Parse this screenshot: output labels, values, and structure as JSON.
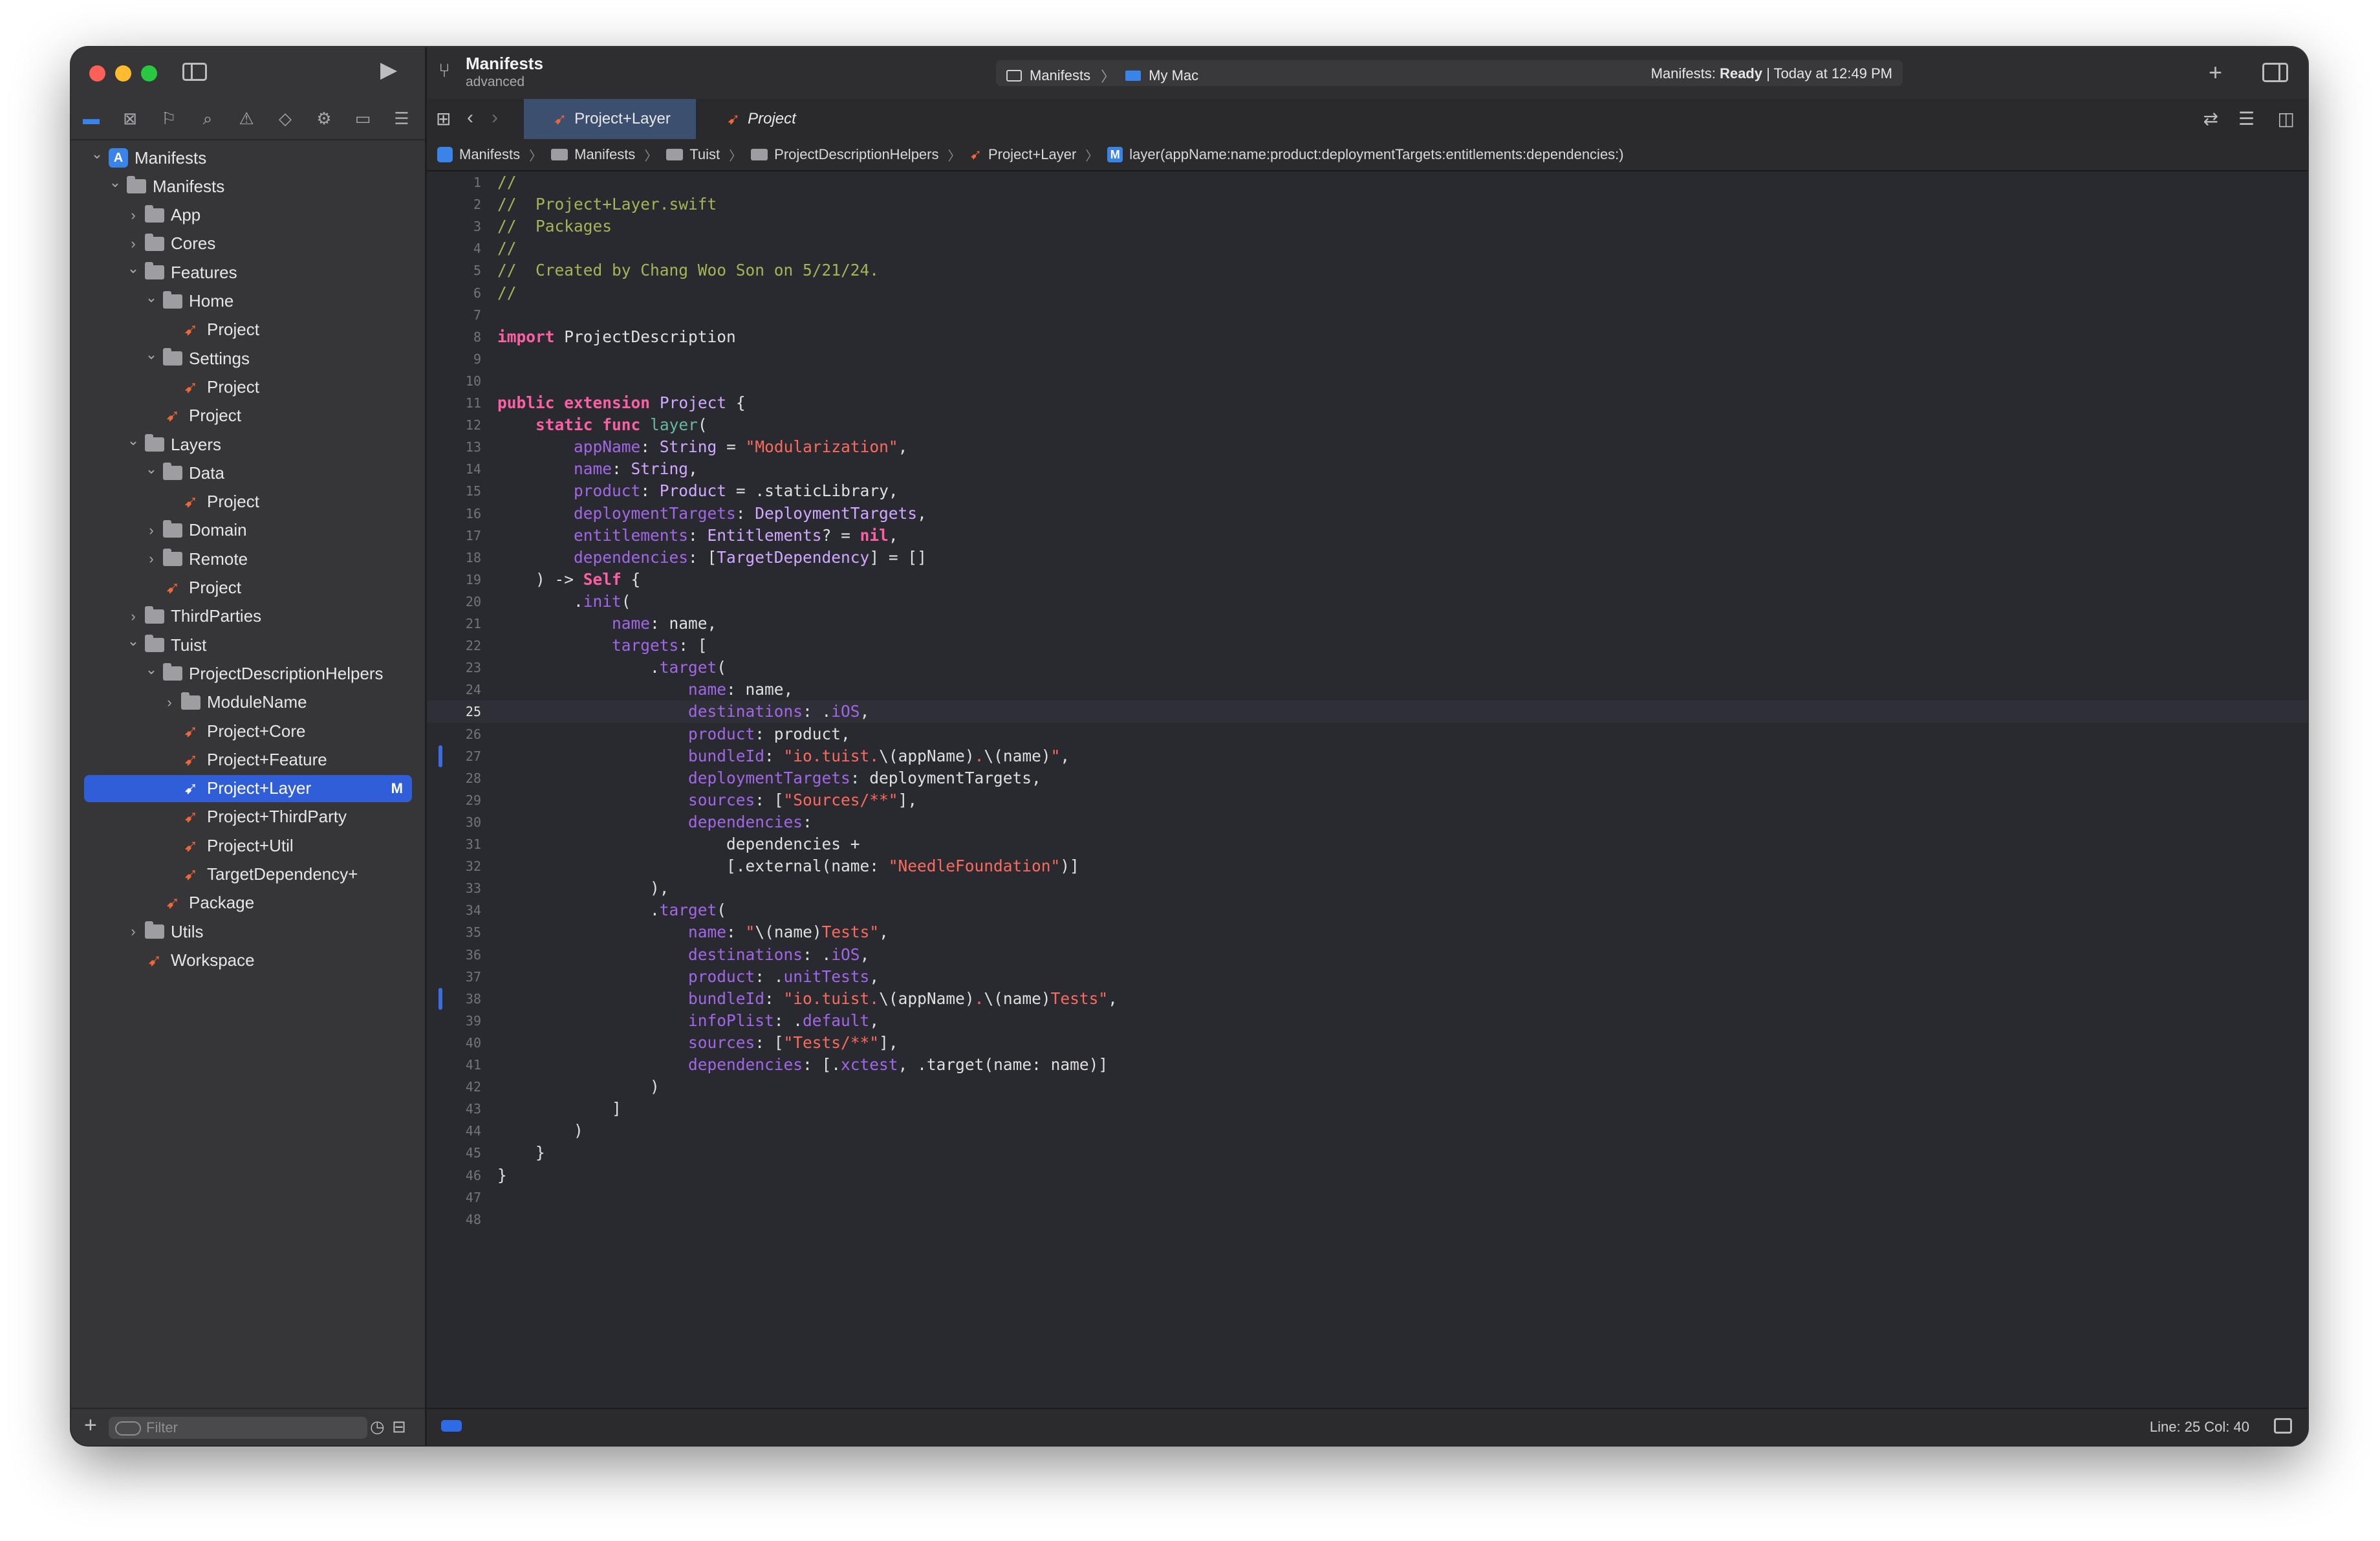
{
  "window": {
    "project_name": "Manifests",
    "branch": "advanced",
    "scheme": "Manifests",
    "destination": "My Mac",
    "status_prefix": "Manifests: ",
    "status_state": "Ready",
    "status_suffix": " | Today at 12:49 PM"
  },
  "tabs": [
    {
      "label": "Project+Layer",
      "active": true
    },
    {
      "label": "Project",
      "active": false
    }
  ],
  "breadcrumbs": [
    "Manifests",
    "Manifests",
    "Tuist",
    "ProjectDescriptionHelpers",
    "Project+Layer",
    "layer(appName:name:product:deploymentTargets:entitlements:dependencies:)"
  ],
  "navigator": {
    "filter_placeholder": "Filter",
    "items": [
      {
        "label": "Manifests",
        "depth": 0,
        "kind": "project",
        "chevron": "down"
      },
      {
        "label": "Manifests",
        "depth": 1,
        "kind": "folder",
        "chevron": "down"
      },
      {
        "label": "App",
        "depth": 2,
        "kind": "folder",
        "chevron": "right"
      },
      {
        "label": "Cores",
        "depth": 2,
        "kind": "folder",
        "chevron": "right"
      },
      {
        "label": "Features",
        "depth": 2,
        "kind": "folder",
        "chevron": "down"
      },
      {
        "label": "Home",
        "depth": 3,
        "kind": "folder",
        "chevron": "down"
      },
      {
        "label": "Project",
        "depth": 4,
        "kind": "swift",
        "chevron": ""
      },
      {
        "label": "Settings",
        "depth": 3,
        "kind": "folder",
        "chevron": "down"
      },
      {
        "label": "Project",
        "depth": 4,
        "kind": "swift",
        "chevron": ""
      },
      {
        "label": "Project",
        "depth": 3,
        "kind": "swift",
        "chevron": ""
      },
      {
        "label": "Layers",
        "depth": 2,
        "kind": "folder",
        "chevron": "down"
      },
      {
        "label": "Data",
        "depth": 3,
        "kind": "folder",
        "chevron": "down"
      },
      {
        "label": "Project",
        "depth": 4,
        "kind": "swift",
        "chevron": ""
      },
      {
        "label": "Domain",
        "depth": 3,
        "kind": "folder",
        "chevron": "right"
      },
      {
        "label": "Remote",
        "depth": 3,
        "kind": "folder",
        "chevron": "right"
      },
      {
        "label": "Project",
        "depth": 3,
        "kind": "swift",
        "chevron": ""
      },
      {
        "label": "ThirdParties",
        "depth": 2,
        "kind": "folder",
        "chevron": "right"
      },
      {
        "label": "Tuist",
        "depth": 2,
        "kind": "folder",
        "chevron": "down"
      },
      {
        "label": "ProjectDescriptionHelpers",
        "depth": 3,
        "kind": "folder",
        "chevron": "down"
      },
      {
        "label": "ModuleName",
        "depth": 4,
        "kind": "folder",
        "chevron": "right"
      },
      {
        "label": "Project+Core",
        "depth": 4,
        "kind": "swift",
        "chevron": ""
      },
      {
        "label": "Project+Feature",
        "depth": 4,
        "kind": "swift",
        "chevron": ""
      },
      {
        "label": "Project+Layer",
        "depth": 4,
        "kind": "swift",
        "chevron": "",
        "selected": true,
        "badge": "M"
      },
      {
        "label": "Project+ThirdParty",
        "depth": 4,
        "kind": "swift",
        "chevron": ""
      },
      {
        "label": "Project+Util",
        "depth": 4,
        "kind": "swift",
        "chevron": ""
      },
      {
        "label": "TargetDependency+",
        "depth": 4,
        "kind": "swift",
        "chevron": ""
      },
      {
        "label": "Package",
        "depth": 3,
        "kind": "swift",
        "chevron": ""
      },
      {
        "label": "Utils",
        "depth": 2,
        "kind": "folder",
        "chevron": "right"
      },
      {
        "label": "Workspace",
        "depth": 2,
        "kind": "swift",
        "chevron": ""
      }
    ]
  },
  "editor": {
    "current_line": 25,
    "modified_lines": [
      27,
      38
    ],
    "lines": [
      [
        [
          "cm",
          "//"
        ]
      ],
      [
        [
          "cm",
          "//  Project+Layer.swift"
        ]
      ],
      [
        [
          "cm",
          "//  Packages"
        ]
      ],
      [
        [
          "cm",
          "//"
        ]
      ],
      [
        [
          "cm",
          "//  Created by Chang Woo Son on 5/21/24."
        ]
      ],
      [
        [
          "cm",
          "//"
        ]
      ],
      [],
      [
        [
          "kw",
          "import"
        ],
        [
          "pl",
          " ProjectDescription"
        ]
      ],
      [],
      [],
      [
        [
          "kw",
          "public"
        ],
        [
          "pl",
          " "
        ],
        [
          "kw",
          "extension"
        ],
        [
          "pl",
          " "
        ],
        [
          "ty",
          "Project"
        ],
        [
          "pl",
          " {"
        ]
      ],
      [
        [
          "pl",
          "    "
        ],
        [
          "kw",
          "static"
        ],
        [
          "pl",
          " "
        ],
        [
          "kw",
          "func"
        ],
        [
          "pl",
          " "
        ],
        [
          "fn",
          "layer"
        ],
        [
          "pl",
          "("
        ]
      ],
      [
        [
          "pl",
          "        "
        ],
        [
          "pr",
          "appName"
        ],
        [
          "pl",
          ": "
        ],
        [
          "ty",
          "String"
        ],
        [
          "pl",
          " = "
        ],
        [
          "st",
          "\"Modularization\""
        ],
        [
          "pl",
          ","
        ]
      ],
      [
        [
          "pl",
          "        "
        ],
        [
          "pr",
          "name"
        ],
        [
          "pl",
          ": "
        ],
        [
          "ty",
          "String"
        ],
        [
          "pl",
          ","
        ]
      ],
      [
        [
          "pl",
          "        "
        ],
        [
          "pr",
          "product"
        ],
        [
          "pl",
          ": "
        ],
        [
          "ty",
          "Product"
        ],
        [
          "pl",
          " = .staticLibrary,"
        ]
      ],
      [
        [
          "pl",
          "        "
        ],
        [
          "pr",
          "deploymentTargets"
        ],
        [
          "pl",
          ": "
        ],
        [
          "ty",
          "DeploymentTargets"
        ],
        [
          "pl",
          ","
        ]
      ],
      [
        [
          "pl",
          "        "
        ],
        [
          "pr",
          "entitlements"
        ],
        [
          "pl",
          ": "
        ],
        [
          "ty",
          "Entitlements"
        ],
        [
          "pl",
          "? = "
        ],
        [
          "kw",
          "nil"
        ],
        [
          "pl",
          ","
        ]
      ],
      [
        [
          "pl",
          "        "
        ],
        [
          "pr",
          "dependencies"
        ],
        [
          "pl",
          ": ["
        ],
        [
          "ty",
          "TargetDependency"
        ],
        [
          "pl",
          "] = []"
        ]
      ],
      [
        [
          "pl",
          "    ) -> "
        ],
        [
          "kw",
          "Self"
        ],
        [
          "pl",
          " {"
        ]
      ],
      [
        [
          "pl",
          "        ."
        ],
        [
          "pr",
          "init"
        ],
        [
          "pl",
          "("
        ]
      ],
      [
        [
          "pl",
          "            "
        ],
        [
          "pr",
          "name"
        ],
        [
          "pl",
          ": name,"
        ]
      ],
      [
        [
          "pl",
          "            "
        ],
        [
          "pr",
          "targets"
        ],
        [
          "pl",
          ": ["
        ]
      ],
      [
        [
          "pl",
          "                ."
        ],
        [
          "pr",
          "target"
        ],
        [
          "pl",
          "("
        ]
      ],
      [
        [
          "pl",
          "                    "
        ],
        [
          "pr",
          "name"
        ],
        [
          "pl",
          ": name,"
        ]
      ],
      [
        [
          "pl",
          "                    "
        ],
        [
          "pr",
          "destinations"
        ],
        [
          "pl",
          ": ."
        ],
        [
          "pr",
          "iOS"
        ],
        [
          "pl",
          ","
        ]
      ],
      [
        [
          "pl",
          "                    "
        ],
        [
          "pr",
          "product"
        ],
        [
          "pl",
          ": product,"
        ]
      ],
      [
        [
          "pl",
          "                    "
        ],
        [
          "pr",
          "bundleId"
        ],
        [
          "pl",
          ": "
        ],
        [
          "st",
          "\"io.tuist."
        ],
        [
          "pl",
          "\\(appName)"
        ],
        [
          "st",
          "."
        ],
        [
          "pl",
          "\\(name)"
        ],
        [
          "st",
          "\""
        ],
        [
          "pl",
          ","
        ]
      ],
      [
        [
          "pl",
          "                    "
        ],
        [
          "pr",
          "deploymentTargets"
        ],
        [
          "pl",
          ": deploymentTargets,"
        ]
      ],
      [
        [
          "pl",
          "                    "
        ],
        [
          "pr",
          "sources"
        ],
        [
          "pl",
          ": ["
        ],
        [
          "st",
          "\"Sources/**\""
        ],
        [
          "pl",
          "],"
        ]
      ],
      [
        [
          "pl",
          "                    "
        ],
        [
          "pr",
          "dependencies"
        ],
        [
          "pl",
          ":"
        ]
      ],
      [
        [
          "pl",
          "                        dependencies +"
        ]
      ],
      [
        [
          "pl",
          "                        [.external(name: "
        ],
        [
          "st",
          "\"NeedleFoundation\""
        ],
        [
          "pl",
          ")]"
        ]
      ],
      [
        [
          "pl",
          "                ),"
        ]
      ],
      [
        [
          "pl",
          "                ."
        ],
        [
          "pr",
          "target"
        ],
        [
          "pl",
          "("
        ]
      ],
      [
        [
          "pl",
          "                    "
        ],
        [
          "pr",
          "name"
        ],
        [
          "pl",
          ": "
        ],
        [
          "st",
          "\""
        ],
        [
          "pl",
          "\\(name)"
        ],
        [
          "st",
          "Tests\""
        ],
        [
          "pl",
          ","
        ]
      ],
      [
        [
          "pl",
          "                    "
        ],
        [
          "pr",
          "destinations"
        ],
        [
          "pl",
          ": ."
        ],
        [
          "pr",
          "iOS"
        ],
        [
          "pl",
          ","
        ]
      ],
      [
        [
          "pl",
          "                    "
        ],
        [
          "pr",
          "product"
        ],
        [
          "pl",
          ": ."
        ],
        [
          "pr",
          "unitTests"
        ],
        [
          "pl",
          ","
        ]
      ],
      [
        [
          "pl",
          "                    "
        ],
        [
          "pr",
          "bundleId"
        ],
        [
          "pl",
          ": "
        ],
        [
          "st",
          "\"io.tuist."
        ],
        [
          "pl",
          "\\(appName)"
        ],
        [
          "st",
          "."
        ],
        [
          "pl",
          "\\(name)"
        ],
        [
          "st",
          "Tests\""
        ],
        [
          "pl",
          ","
        ]
      ],
      [
        [
          "pl",
          "                    "
        ],
        [
          "pr",
          "infoPlist"
        ],
        [
          "pl",
          ": ."
        ],
        [
          "pr",
          "default"
        ],
        [
          "pl",
          ","
        ]
      ],
      [
        [
          "pl",
          "                    "
        ],
        [
          "pr",
          "sources"
        ],
        [
          "pl",
          ": ["
        ],
        [
          "st",
          "\"Tests/**\""
        ],
        [
          "pl",
          "],"
        ]
      ],
      [
        [
          "pl",
          "                    "
        ],
        [
          "pr",
          "dependencies"
        ],
        [
          "pl",
          ": [."
        ],
        [
          "pr",
          "xctest"
        ],
        [
          "pl",
          ", .target(name: name)]"
        ]
      ],
      [
        [
          "pl",
          "                )"
        ]
      ],
      [
        [
          "pl",
          "            ]"
        ]
      ],
      [
        [
          "pl",
          "        )"
        ]
      ],
      [
        [
          "pl",
          "    }"
        ]
      ],
      [
        [
          "pl",
          "}"
        ]
      ],
      [],
      []
    ]
  },
  "statusbar": {
    "position": "Line: 25  Col: 40"
  },
  "colors": {
    "accent": "#2f5ed8",
    "keyword": "#fc5fa3",
    "comment": "#a6b456",
    "string": "#fc6a5d",
    "type": "#d0a8ff",
    "property": "#a167e6",
    "function": "#67b7a4"
  },
  "icons": {
    "navigator": [
      "folder-icon",
      "source-control-icon",
      "bookmark-icon",
      "find-icon",
      "issue-icon",
      "test-icon",
      "debug-icon",
      "breakpoint-icon",
      "report-icon"
    ]
  }
}
